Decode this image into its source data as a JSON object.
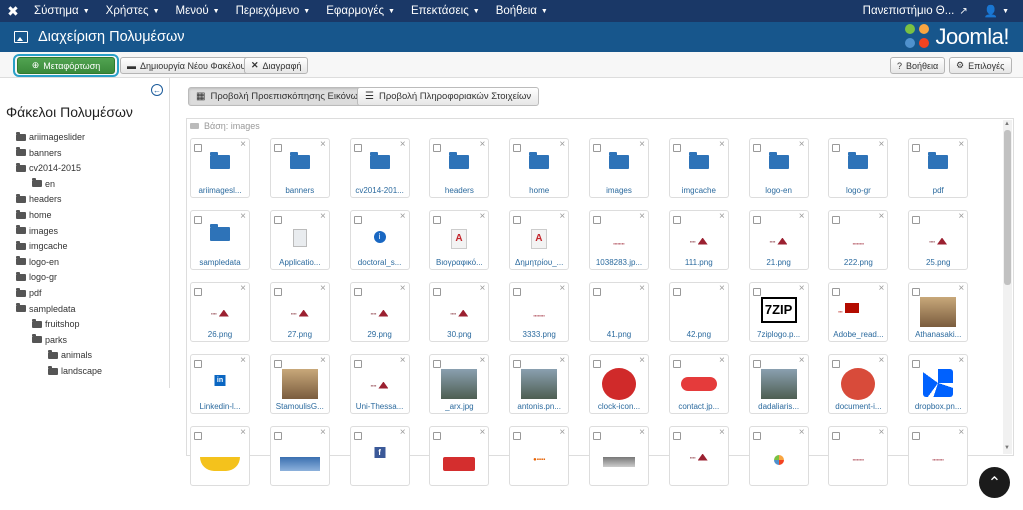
{
  "topnav": {
    "menus": [
      "Σύστημα",
      "Χρήστες",
      "Μενού",
      "Περιεχόμενο",
      "Εφαρμογές",
      "Επεκτάσεις",
      "Βοήθεια"
    ],
    "site_name": "Πανεπιστήμιο Θ...",
    "user_icon": "user-icon"
  },
  "header": {
    "title": "Διαχείριση Πολυμέσων",
    "brand": "Joomla!"
  },
  "toolbar": {
    "upload": "Μεταφόρτωση",
    "new_folder": "Δημιουργία Νέου Φακέλου",
    "delete": "Διαγραφή",
    "help": "Βοήθεια",
    "options": "Επιλογές"
  },
  "sidebar": {
    "title": "Φάκελοι Πολυμέσων",
    "folders": [
      {
        "label": "ariimageslider",
        "level": 0
      },
      {
        "label": "banners",
        "level": 0
      },
      {
        "label": "cv2014-2015",
        "level": 0
      },
      {
        "label": "en",
        "level": 1
      },
      {
        "label": "headers",
        "level": 0
      },
      {
        "label": "home",
        "level": 0
      },
      {
        "label": "images",
        "level": 0
      },
      {
        "label": "imgcache",
        "level": 0
      },
      {
        "label": "logo-en",
        "level": 0
      },
      {
        "label": "logo-gr",
        "level": 0
      },
      {
        "label": "pdf",
        "level": 0
      },
      {
        "label": "sampledata",
        "level": 0
      },
      {
        "label": "fruitshop",
        "level": 1
      },
      {
        "label": "parks",
        "level": 1
      },
      {
        "label": "animals",
        "level": 2
      },
      {
        "label": "landscape",
        "level": 2
      }
    ]
  },
  "views": {
    "thumbnails": "Προβολή Προεπισκόπησης Εικόνων",
    "details": "Προβολή Πληροφοριακών Στοιχείων"
  },
  "breadcrumb": "Βάση: images",
  "tiles": [
    {
      "label": "ariimagesl...",
      "kind": "folder"
    },
    {
      "label": "banners",
      "kind": "folder"
    },
    {
      "label": "cv2014-201...",
      "kind": "folder"
    },
    {
      "label": "headers",
      "kind": "folder"
    },
    {
      "label": "home",
      "kind": "folder"
    },
    {
      "label": "images",
      "kind": "folder"
    },
    {
      "label": "imgcache",
      "kind": "folder"
    },
    {
      "label": "logo-en",
      "kind": "folder"
    },
    {
      "label": "logo-gr",
      "kind": "folder"
    },
    {
      "label": "pdf",
      "kind": "folder"
    },
    {
      "label": "sampledata",
      "kind": "folder"
    },
    {
      "label": "Applicatio...",
      "kind": "appl"
    },
    {
      "label": "doctoral_s...",
      "kind": "info"
    },
    {
      "label": "Βιογραφικό...",
      "kind": "pdf"
    },
    {
      "label": "Δημητρίου_...",
      "kind": "pdf"
    },
    {
      "label": "1038283.jp...",
      "kind": "logoline"
    },
    {
      "label": "111.png",
      "kind": "logo"
    },
    {
      "label": "21.png",
      "kind": "logo"
    },
    {
      "label": "222.png",
      "kind": "logoline"
    },
    {
      "label": "25.png",
      "kind": "logo"
    },
    {
      "label": "26.png",
      "kind": "logo"
    },
    {
      "label": "27.png",
      "kind": "logo"
    },
    {
      "label": "29.png",
      "kind": "logo"
    },
    {
      "label": "30.png",
      "kind": "logo"
    },
    {
      "label": "3333.png",
      "kind": "logoline"
    },
    {
      "label": "41.png",
      "kind": "empty"
    },
    {
      "label": "42.png",
      "kind": "empty"
    },
    {
      "label": "7ziplogo.p...",
      "kind": "7zip"
    },
    {
      "label": "Adobe_read...",
      "kind": "adobe"
    },
    {
      "label": "Athanasaki...",
      "kind": "photo"
    },
    {
      "label": "Linkedin-l...",
      "kind": "linkedin"
    },
    {
      "label": "StamoulisG...",
      "kind": "photo"
    },
    {
      "label": "Uni-Thessa...",
      "kind": "logo"
    },
    {
      "label": "_arx.jpg",
      "kind": "photo2"
    },
    {
      "label": "antonis.pn...",
      "kind": "photo2"
    },
    {
      "label": "clock-icon...",
      "kind": "redcircle"
    },
    {
      "label": "contact.jp...",
      "kind": "contact"
    },
    {
      "label": "dadaliaris...",
      "kind": "photo2"
    },
    {
      "label": "document-i...",
      "kind": "doc"
    },
    {
      "label": "dropbox.pn...",
      "kind": "dropbox"
    },
    {
      "label": "",
      "kind": "yellow"
    },
    {
      "label": "",
      "kind": "blue"
    },
    {
      "label": "",
      "kind": "fb"
    },
    {
      "label": "",
      "kind": "redbox"
    },
    {
      "label": "",
      "kind": "firefox"
    },
    {
      "label": "",
      "kind": "gray"
    },
    {
      "label": "",
      "kind": "logo"
    },
    {
      "label": "",
      "kind": "joomla"
    },
    {
      "label": "",
      "kind": "logoline"
    },
    {
      "label": "",
      "kind": "logoline"
    }
  ],
  "colors": {
    "navbar": "#1a3867",
    "subhead": "#17568c",
    "upload_green": "#4a9e4a",
    "folder_blue": "#2e73b8"
  }
}
